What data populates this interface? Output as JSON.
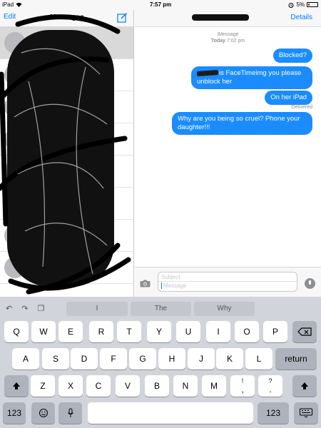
{
  "status_bar": {
    "device": "iPad",
    "time": "7:57 pm",
    "battery": "5%"
  },
  "messages_list": {
    "edit_label": "Edit",
    "title": "Messages"
  },
  "thread": {
    "details_label": "Details",
    "service": "iMessage",
    "day": "Today",
    "time": "7:02 pm",
    "messages": [
      {
        "text": "Blocked?"
      },
      {
        "text": "is FaceTimeimg you please unblock her"
      },
      {
        "text": "On her iPad"
      },
      {
        "text": "Why are you being so cruel? Phone your daughter!!!"
      }
    ],
    "delivered": "Delivered",
    "compose": {
      "subject_placeholder": "Subject",
      "message_placeholder": "Message"
    }
  },
  "keyboard": {
    "predictions": [
      "I",
      "The",
      "Why"
    ],
    "row1": [
      "Q",
      "W",
      "E",
      "R",
      "T",
      "Y",
      "U",
      "I",
      "O",
      "P"
    ],
    "row2": [
      "A",
      "S",
      "D",
      "F",
      "G",
      "H",
      "J",
      "K",
      "L"
    ],
    "row3": [
      "Z",
      "X",
      "C",
      "V",
      "B",
      "N",
      "M"
    ],
    "return_label": "return",
    "numbers_label": "123",
    "punct1": {
      "top": "!",
      "bottom": ","
    },
    "punct2": {
      "top": "?",
      "bottom": "."
    }
  }
}
